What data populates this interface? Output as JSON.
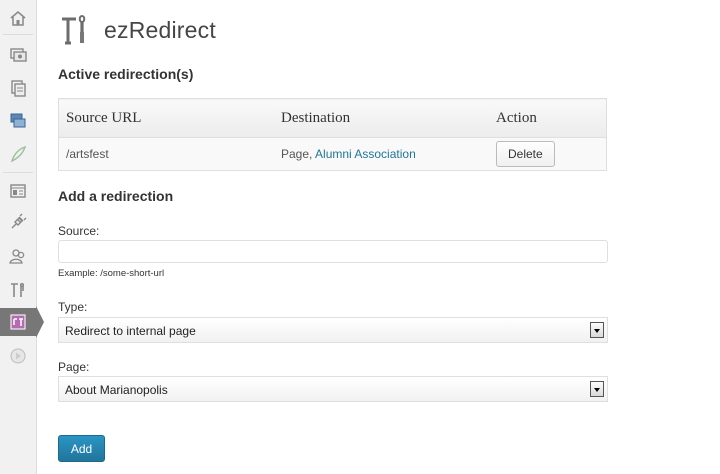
{
  "header": {
    "title": "ezRedirect",
    "icon": "tools-icon"
  },
  "sidebar": {
    "items": [
      {
        "icon": "home-icon"
      },
      {
        "icon": "media-icon"
      },
      {
        "icon": "pages-icon"
      },
      {
        "icon": "links-icon"
      },
      {
        "icon": "appearance-icon"
      },
      {
        "icon": "widgets-icon"
      },
      {
        "icon": "plugins-icon"
      },
      {
        "icon": "users-icon"
      },
      {
        "icon": "tools-icon"
      },
      {
        "icon": "ezredirect-icon",
        "current": true
      },
      {
        "icon": "collapse-menu-icon"
      }
    ]
  },
  "active": {
    "heading": "Active redirection(s)",
    "columns": [
      "Source URL",
      "Destination",
      "Action"
    ],
    "rows": [
      {
        "source": "/artsfest",
        "dest_prefix": "Page,",
        "dest_link": "Alumni Association",
        "action": "Delete"
      }
    ]
  },
  "add": {
    "heading": "Add a redirection",
    "source_label": "Source:",
    "source_value": "",
    "source_example": "Example: /some-short-url",
    "type_label": "Type:",
    "type_value": "Redirect to internal page",
    "page_label": "Page:",
    "page_value": "About Marianopolis",
    "submit": "Add"
  },
  "colors": {
    "accent": "#21759b",
    "sidebar_current": "#777777"
  }
}
